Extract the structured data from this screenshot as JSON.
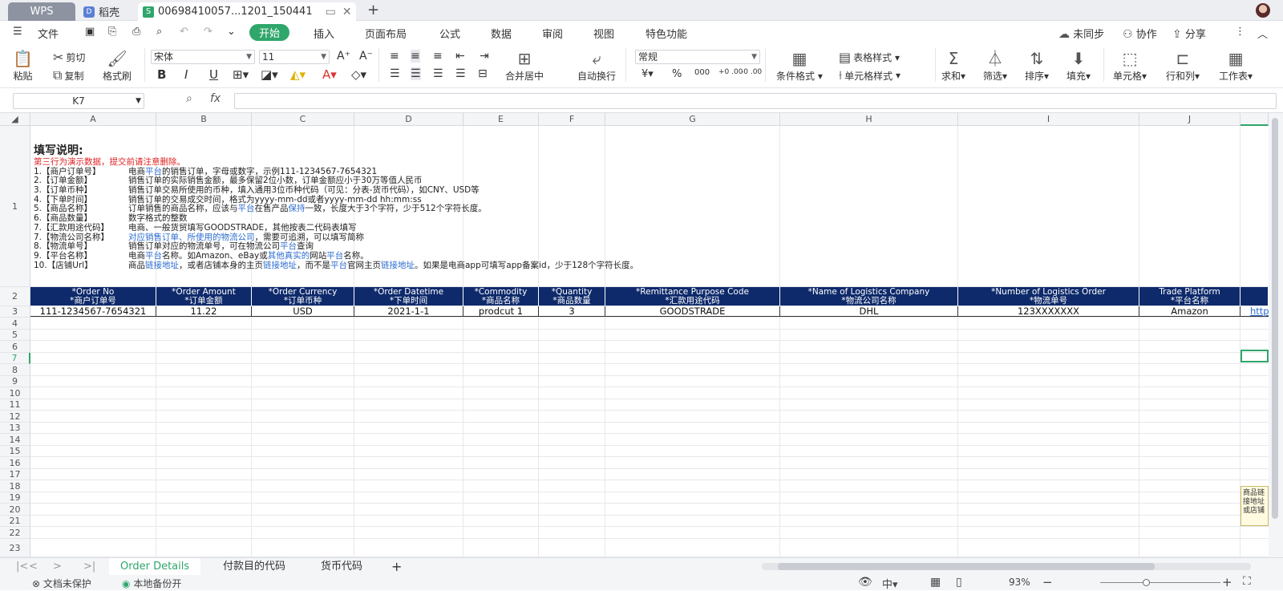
{
  "tabs": {
    "wps": "WPS",
    "daoke": "稻壳",
    "file": "00698410057...1201_150441"
  },
  "menu": {
    "file": "文件",
    "items": [
      "开始",
      "插入",
      "页面布局",
      "公式",
      "数据",
      "审阅",
      "视图",
      "特色功能"
    ],
    "sync": "未同步",
    "collab": "协作",
    "share": "分享"
  },
  "ribbon": {
    "paste": "粘贴",
    "cut": "剪切",
    "copy": "复制",
    "format_painter": "格式刷",
    "font": "宋体",
    "size": "11",
    "bold": "B",
    "italic": "I",
    "underline": "U",
    "merge": "合并居中",
    "wrap": "自动换行",
    "numfmt": "常规",
    "cond": "条件格式",
    "table_style": "表格样式",
    "cell_style": "单元格样式",
    "sum": "求和",
    "filter": "筛选",
    "sort": "排序",
    "fill": "填充",
    "cell": "单元格",
    "rowcol": "行和列",
    "sheet": "工作表",
    "yen": "¥",
    "pct": "%",
    "thou": "000",
    "dec_inc": "+0 .00",
    "dec_dec": "-0 .00"
  },
  "formula": {
    "cell_ref": "K7",
    "fx": "fx"
  },
  "columns": [
    "A",
    "B",
    "C",
    "D",
    "E",
    "F",
    "G",
    "H",
    "I",
    "J"
  ],
  "rows": [
    "1",
    "2",
    "3",
    "4",
    "5",
    "6",
    "7",
    "8",
    "9",
    "10",
    "11",
    "12",
    "13",
    "14",
    "15",
    "16",
    "17",
    "18",
    "19",
    "20",
    "21",
    "22",
    "23"
  ],
  "instructions": {
    "title": "填写说明:",
    "warning": "第三行为演示数据，提交前请注意删除。",
    "lines": [
      {
        "k": "1.【商户订单号】",
        "v": "电商平台的销售订单，字母或数字，示例111-1234567-7654321"
      },
      {
        "k": "2.【订单金额】",
        "v": "销售订单的实际销售金额，最多保留2位小数，订单金额应小于30万等值人民币"
      },
      {
        "k": "3.【订单币种】",
        "v": "销售订单交易所使用的币种，填入通用3位币种代码（可见：分表-货币代码），如CNY、USD等"
      },
      {
        "k": "4.【下单时间】",
        "v": "销售订单的交易成交时间，格式为yyyy-mm-dd或者yyyy-mm-dd hh:mm:ss"
      },
      {
        "k": "5.【商品名称】",
        "v": "订单销售的商品名称，应该与平台在售产品保持一致，长度大于3个字符，少于512个字符长度。"
      },
      {
        "k": "6.【商品数量】",
        "v": "数字格式的整数"
      },
      {
        "k": "7.【汇款用途代码】",
        "v": "电商、一般货贸填写GOODSTRADE，其他按表二代码表填写"
      },
      {
        "k": "7.【物流公司名称】",
        "v": "对应销售订单、所使用的物流公司，需要可追溯，可以填写简称"
      },
      {
        "k": "8.【物流单号】",
        "v": "销售订单对应的物流单号，可在物流公司平台查询"
      },
      {
        "k": "9.【平台名称】",
        "v": "电商平台名称。如Amazon、eBay或其他真实的网站平台名称。"
      },
      {
        "k": "10.【店铺Url】",
        "v": "商品链接地址，或者店铺本身的主页链接地址，而不是平台官网主页链接地址。如果是电商app可填写app备案id，少于128个字符长度。"
      }
    ]
  },
  "headers": [
    {
      "en": "*Order No",
      "cn": "*商户订单号"
    },
    {
      "en": "*Order Amount",
      "cn": "*订单金额"
    },
    {
      "en": "*Order Currency",
      "cn": "*订单币种"
    },
    {
      "en": "*Order Datetime",
      "cn": "*下单时间"
    },
    {
      "en": "*Commodity",
      "cn": "*商品名称"
    },
    {
      "en": "*Quantity",
      "cn": "*商品数量"
    },
    {
      "en": "*Remittance Purpose Code",
      "cn": "*汇款用途代码"
    },
    {
      "en": "*Name of Logistics Company",
      "cn": "*物流公司名称"
    },
    {
      "en": "*Number of Logistics Order",
      "cn": "*物流单号"
    },
    {
      "en": "Trade Platform",
      "cn": "*平台名称"
    }
  ],
  "row3": [
    "111-1234567-7654321",
    "11.22",
    "USD",
    "2021-1-1",
    "prodcut 1",
    "3",
    "GOODSTRADE",
    "DHL",
    "123XXXXXXX",
    "Amazon",
    "http"
  ],
  "tooltip": "商品链接地址或店铺",
  "sheets": [
    "Order Details",
    "付款目的代码",
    "货币代码"
  ],
  "status": {
    "protect": "文档未保护",
    "backup": "本地备份开",
    "zoom": "93%"
  },
  "colors": {
    "accent": "#2fa66a",
    "header_bg": "#0e2a6b",
    "warning": "#e02020",
    "link": "#2c6ccf"
  }
}
